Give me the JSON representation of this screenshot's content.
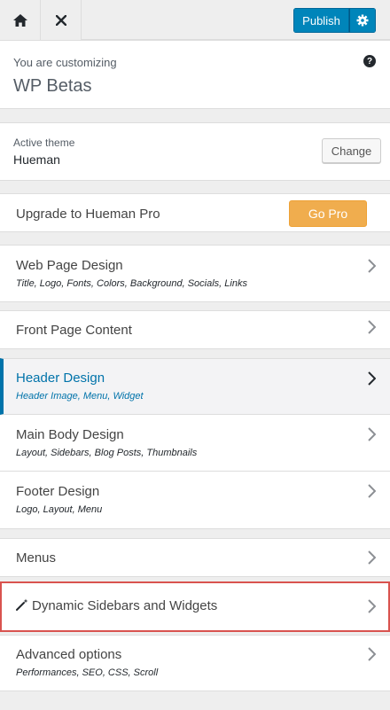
{
  "topbar": {
    "home_icon": "home-icon",
    "close_icon": "close-icon",
    "publish_label": "Publish",
    "settings_icon": "gear-icon",
    "accent_color": "#0085ba"
  },
  "customizing": {
    "label": "You are customizing",
    "site_name": "WP Betas",
    "help_icon": "question-icon"
  },
  "theme": {
    "label": "Active theme",
    "name": "Hueman",
    "change_label": "Change"
  },
  "upgrade": {
    "label": "Upgrade to Hueman Pro",
    "go_pro_label": "Go Pro",
    "go_pro_color": "#f0ad4e"
  },
  "sections": [
    {
      "title": "Web Page Design",
      "subtitle": "Title, Logo, Fonts, Colors, Background, Socials, Links"
    },
    {
      "title": "Front Page Content",
      "subtitle": ""
    },
    {
      "title": "Header Design",
      "subtitle": "Header Image, Menu, Widget",
      "active": true
    },
    {
      "title": "Main Body Design",
      "subtitle": "Layout, Sidebars, Blog Posts, Thumbnails"
    },
    {
      "title": "Footer Design",
      "subtitle": "Logo, Layout, Menu"
    },
    {
      "title": "Menus",
      "subtitle": ""
    },
    {
      "title": "Dynamic Sidebars and Widgets",
      "subtitle": "",
      "icon": "magic-wand-icon",
      "highlighted": true
    },
    {
      "title": "Advanced options",
      "subtitle": "Performances, SEO, CSS, Scroll"
    }
  ]
}
